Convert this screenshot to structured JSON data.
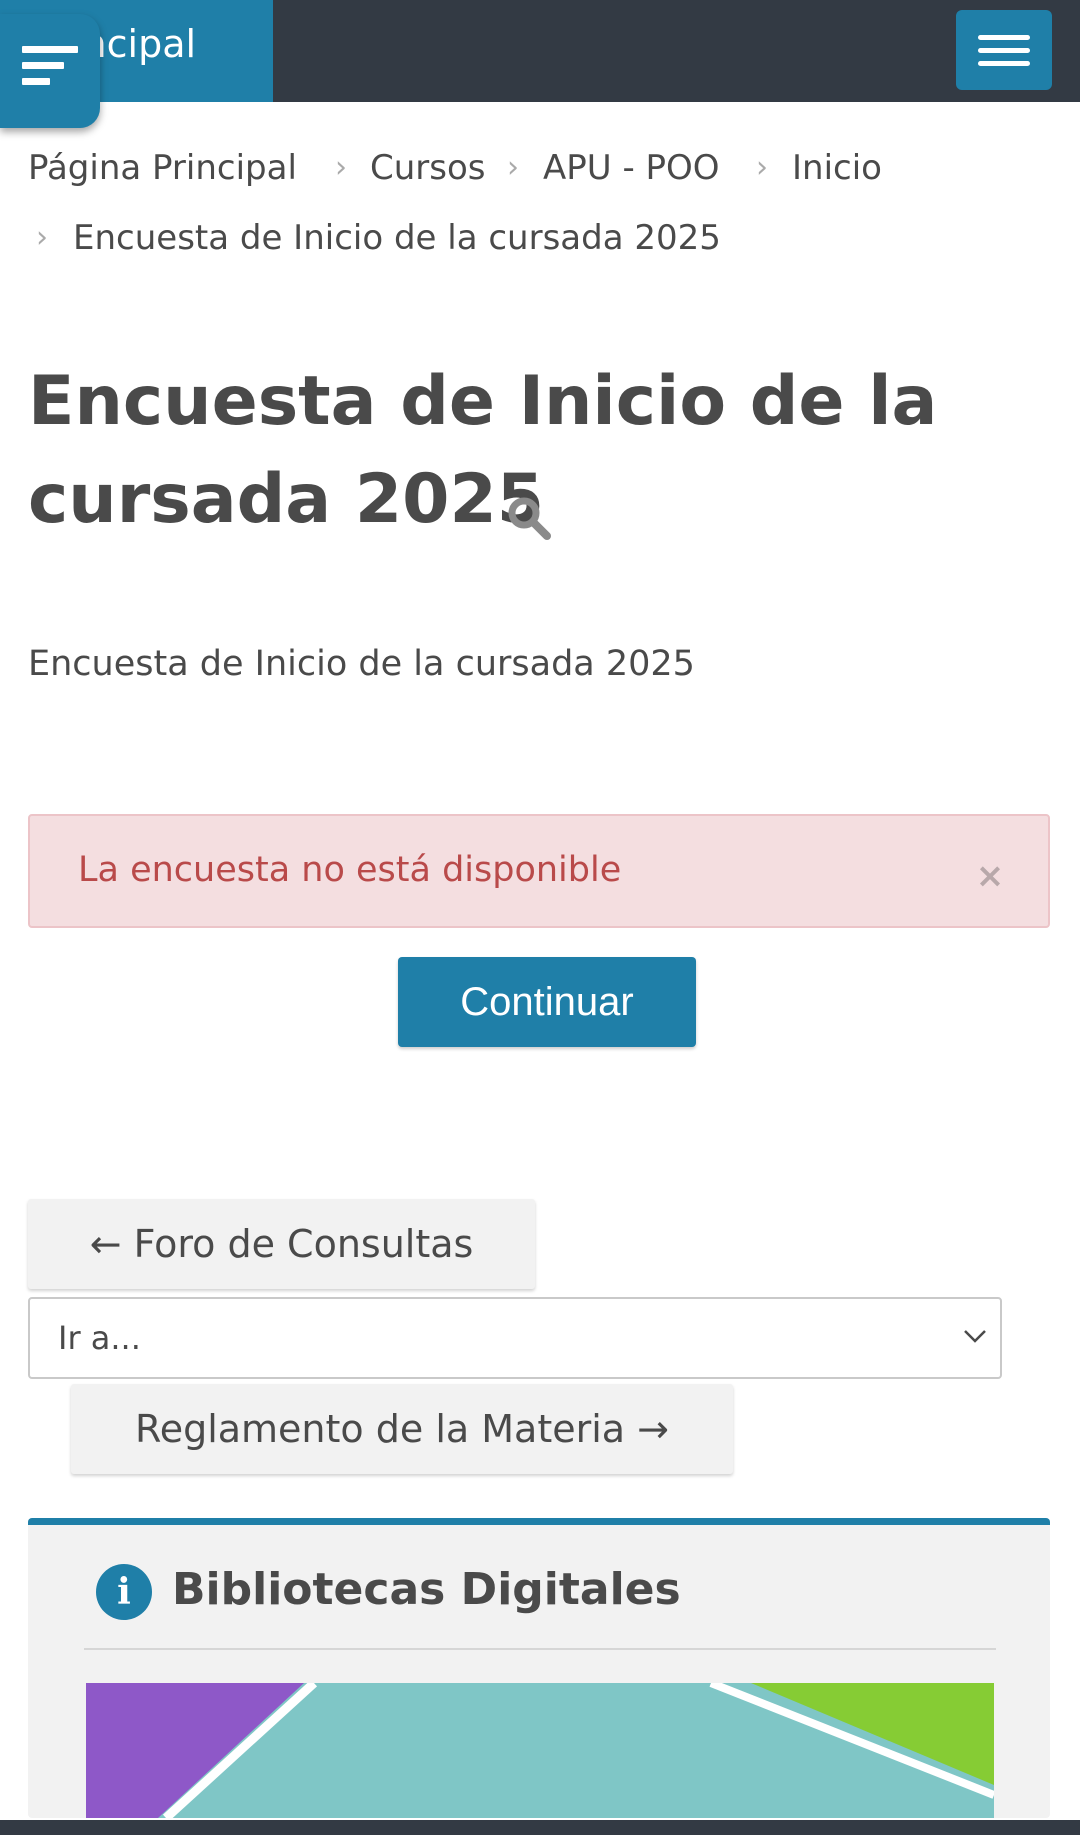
{
  "navbar": {
    "brand_partial": "incipal",
    "drawer_icon": "drawer-toggle-icon",
    "menu_icon": "hamburger-icon"
  },
  "breadcrumb": {
    "items": [
      "Página Principal",
      "Cursos",
      "APU - POO",
      "Inicio",
      "Encuesta de Inicio de la cursada 2025"
    ]
  },
  "page": {
    "title_line1": "Encuesta de Inicio de la",
    "title_line2": "cursada 2025",
    "intro": "Encuesta de Inicio de la cursada 2025"
  },
  "alert": {
    "message": "La encuesta no está disponible",
    "close": "×",
    "color": "#b94a4a"
  },
  "actions": {
    "continue_label": "Continuar"
  },
  "activity_nav": {
    "prev_label": "← Foro de Consultas",
    "jump_placeholder": "Ir a...",
    "next_label": "Reglamento de la Materia →"
  },
  "block": {
    "title": "Bibliotecas Digitales",
    "icon": "info-icon"
  },
  "colors": {
    "accent": "#1f7fa8",
    "navbar": "#333a44"
  }
}
